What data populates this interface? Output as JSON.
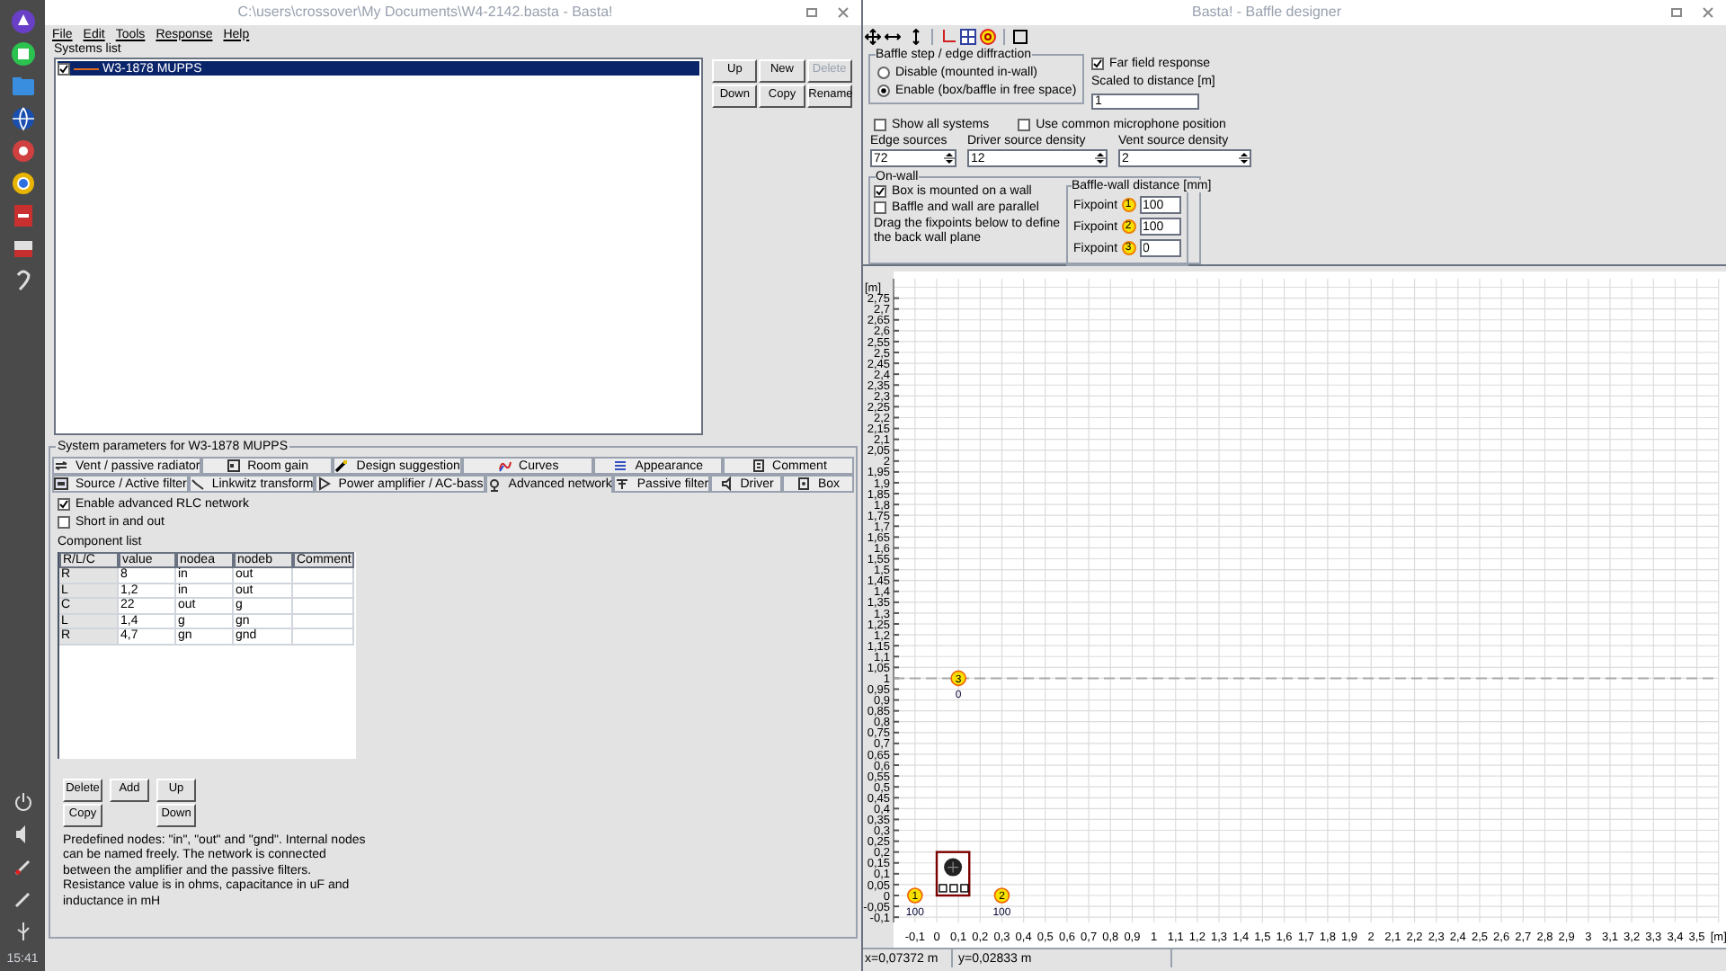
{
  "dock": {
    "clock": "15:41"
  },
  "left_window": {
    "title": "C:\\users\\crossover\\My Documents\\W4-2142.basta - Basta!",
    "menu": [
      "File",
      "Edit",
      "Tools",
      "Response",
      "Help"
    ],
    "systems_list": {
      "label": "Systems list",
      "items": [
        {
          "name": "W3-1878 MUPPS",
          "checked": true,
          "selected": true,
          "color": "#e06a20"
        }
      ]
    },
    "list_buttons": [
      {
        "label": "Up",
        "disabled": false
      },
      {
        "label": "New",
        "disabled": false
      },
      {
        "label": "Delete",
        "disabled": true
      },
      {
        "label": "Down",
        "disabled": false
      },
      {
        "label": "Copy",
        "disabled": false
      },
      {
        "label": "Rename",
        "disabled": false
      }
    ],
    "parameters": {
      "title": "System parameters for W3-1878 MUPPS",
      "tab_rows": [
        {
          "tabs": [
            {
              "label": "Vent / passive radiator",
              "selected": false
            },
            {
              "label": "Room gain",
              "selected": false
            },
            {
              "label": "Design suggestion",
              "selected": false
            },
            {
              "label": "Curves",
              "selected": false
            },
            {
              "label": "Appearance",
              "selected": false
            },
            {
              "label": "Comment",
              "selected": false
            }
          ]
        },
        {
          "tabs": [
            {
              "label": "Source / Active filter",
              "selected": false
            },
            {
              "label": "Linkwitz transform",
              "selected": false
            },
            {
              "label": "Power amplifier / AC-bass",
              "selected": false
            },
            {
              "label": "Advanced network",
              "selected": true
            },
            {
              "label": "Passive filter",
              "selected": false
            },
            {
              "label": "Driver",
              "selected": false
            },
            {
              "label": "Box",
              "selected": false
            }
          ]
        }
      ],
      "options": [
        {
          "label": "Enable advanced RLC network",
          "checked": true
        },
        {
          "label": "Short in and out",
          "checked": false
        }
      ],
      "component_list": {
        "label": "Component list",
        "columns": [
          "R/L/C",
          "value",
          "nodea",
          "nodeb",
          "Comment"
        ],
        "rows": [
          [
            "R",
            "8",
            "in",
            "out",
            ""
          ],
          [
            "L",
            "1,2",
            "in",
            "out",
            ""
          ],
          [
            "C",
            "22",
            "out",
            "g",
            ""
          ],
          [
            "L",
            "1,4",
            "g",
            "gn",
            ""
          ],
          [
            "R",
            "4,7",
            "gn",
            "gnd",
            ""
          ]
        ]
      },
      "buttons": [
        "Delete",
        "Add",
        "Up",
        "Copy",
        "Down"
      ],
      "help": "Predefined nodes: \"in\", \"out\" and \"gnd\". Internal nodes can be named freely. The network is connected between the amplifier and the passive filters. Resistance value is in ohms, capacitance in uF and inductance in mH"
    }
  },
  "right_window": {
    "title": "Basta! - Baffle designer",
    "diffraction": {
      "title": "Baffle step / edge diffraction",
      "options": [
        {
          "label": "Disable (mounted in-wall)",
          "selected": false
        },
        {
          "label": "Enable (box/baffle in free space)",
          "selected": true
        }
      ]
    },
    "far_field": {
      "label": "Far field response",
      "checked": true
    },
    "distance": {
      "label": "Scaled to distance [m]",
      "value": "1"
    },
    "checks": [
      {
        "label": "Show all systems",
        "checked": false
      },
      {
        "label": "Use common microphone position",
        "checked": false
      }
    ],
    "spinners": [
      {
        "label": "Edge sources",
        "value": "72"
      },
      {
        "label": "Driver source density",
        "value": "12"
      },
      {
        "label": "Vent source density",
        "value": "2"
      }
    ],
    "on_wall": {
      "title": "On-wall",
      "options": [
        {
          "label": "Box is mounted on a wall",
          "checked": true
        },
        {
          "label": "Baffle and wall are parallel",
          "checked": false
        }
      ],
      "hint": "Drag the fixpoints below to define the back wall plane",
      "distances": {
        "title": "Baffle-wall distance [mm]",
        "rows": [
          {
            "label": "Fixpoint",
            "number": "1",
            "value": "100"
          },
          {
            "label": "Fixpoint",
            "number": "2",
            "value": "100"
          },
          {
            "label": "Fixpoint",
            "number": "3",
            "value": "0"
          }
        ]
      }
    },
    "plot": {
      "y_unit": "[m]",
      "x_unit": "[m]",
      "y_ticks": [
        "2,75",
        "2,7",
        "2,65",
        "2,6",
        "2,55",
        "2,5",
        "2,45",
        "2,4",
        "2,35",
        "2,3",
        "2,25",
        "2,2",
        "2,15",
        "2,1",
        "2,05",
        "2",
        "1,95",
        "1,9",
        "1,85",
        "1,8",
        "1,75",
        "1,7",
        "1,65",
        "1,6",
        "1,55",
        "1,5",
        "1,45",
        "1,4",
        "1,35",
        "1,3",
        "1,25",
        "1,2",
        "1,15",
        "1,1",
        "1,05",
        "1",
        "0,95",
        "0,9",
        "0,85",
        "0,8",
        "0,75",
        "0,7",
        "0,65",
        "0,6",
        "0,55",
        "0,5",
        "0,45",
        "0,4",
        "0,35",
        "0,3",
        "0,25",
        "0,2",
        "0,15",
        "0,1",
        "0,05",
        "0",
        "-0,05",
        "-0,1"
      ],
      "x_ticks": [
        "-0,1",
        "0",
        "0,1",
        "0,2",
        "0,3",
        "0,4",
        "0,5",
        "0,6",
        "0,7",
        "0,8",
        "0,9",
        "1",
        "1,1",
        "1,2",
        "1,3",
        "1,4",
        "1,5",
        "1,6",
        "1,7",
        "1,8",
        "1,9",
        "2",
        "2,1",
        "2,2",
        "2,3",
        "2,4",
        "2,5",
        "2,6",
        "2,7",
        "2,8",
        "2,9",
        "3",
        "3,1",
        "3,2",
        "3,3",
        "3,4",
        "3,5"
      ],
      "fixpoints": [
        {
          "number": "1",
          "label": "100"
        },
        {
          "number": "2",
          "label": "100"
        },
        {
          "number": "3",
          "label": "0"
        }
      ]
    },
    "status": [
      "x=0,07372 m",
      "y=0,02833 m"
    ]
  }
}
